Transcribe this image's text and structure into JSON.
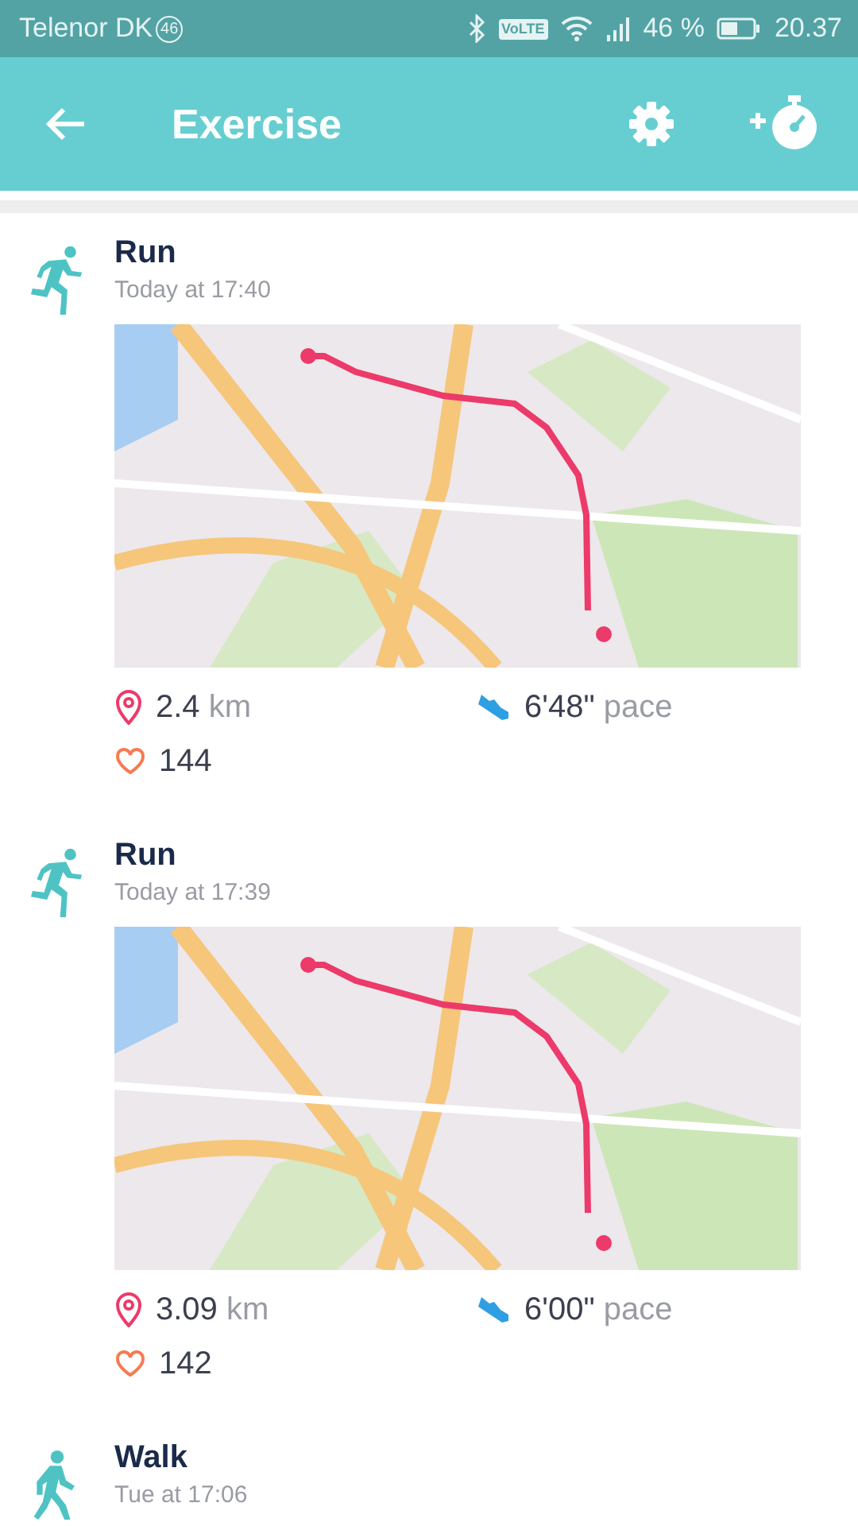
{
  "status_bar": {
    "carrier": "Telenor DK",
    "network_badge": "46",
    "volte": "VoLTE",
    "battery": "46 %",
    "time": "20.37"
  },
  "app_bar": {
    "title": "Exercise"
  },
  "exercises": [
    {
      "kind": "run",
      "title": "Run",
      "time": "Today at 17:40",
      "distance": "2.4",
      "distance_unit": "km",
      "pace": "6'48\"",
      "pace_unit": "pace",
      "heart_rate": "144"
    },
    {
      "kind": "run",
      "title": "Run",
      "time": "Today at 17:39",
      "distance": "3.09",
      "distance_unit": "km",
      "pace": "6'00\"",
      "pace_unit": "pace",
      "heart_rate": "142"
    },
    {
      "kind": "walk",
      "title": "Walk",
      "time": "Tue at 17:06"
    }
  ]
}
